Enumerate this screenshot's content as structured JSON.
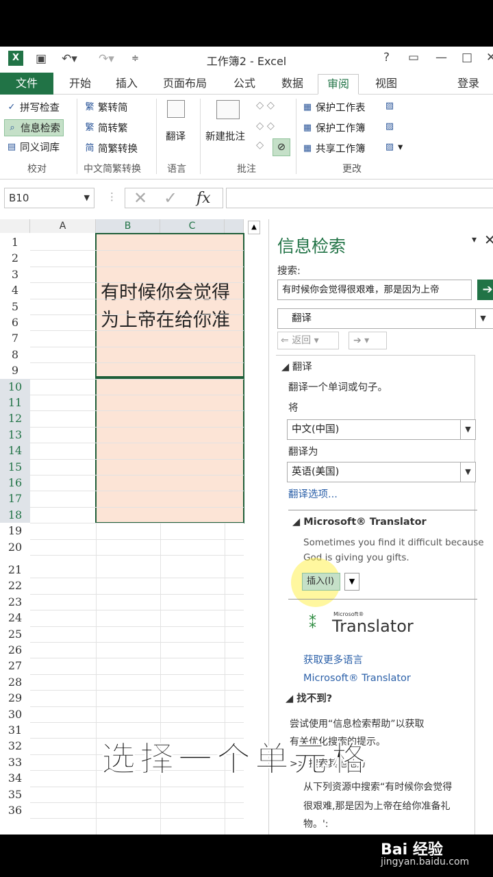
{
  "titlebar": {
    "app_title": "工作簿2 - Excel",
    "help": "?",
    "window_controls": [
      "restore-ribbon",
      "minimize",
      "maximize",
      "close"
    ]
  },
  "tabs": [
    "文件",
    "开始",
    "插入",
    "页面布局",
    "公式",
    "数据",
    "审阅",
    "视图"
  ],
  "active_tab": "审阅",
  "signin": "登录",
  "ribbon": {
    "proofing": {
      "items": [
        "拼写检查",
        "信息检索",
        "同义词库"
      ],
      "label": "校对"
    },
    "chinese": {
      "items": [
        "繁转简",
        "简转繁",
        "简繁转换"
      ],
      "label": "中文简繁转换"
    },
    "language": {
      "items": [
        "翻译"
      ],
      "label": "语言"
    },
    "comments": {
      "items": [
        "新建批注"
      ],
      "label": "批注"
    },
    "changes": {
      "items": [
        "保护工作表",
        "保护工作簿",
        "共享工作簿"
      ],
      "label": "更改"
    }
  },
  "formula_bar": {
    "name_box": "B10",
    "fx": "fx"
  },
  "grid": {
    "columns": [
      "A",
      "B",
      "C"
    ],
    "rows": [
      "1",
      "2",
      "3",
      "4",
      "5",
      "6",
      "7",
      "8",
      "9",
      "10",
      "11",
      "12",
      "13",
      "14",
      "15",
      "16",
      "17",
      "18",
      "19",
      "20",
      "21",
      "22",
      "23",
      "24",
      "25",
      "26",
      "27",
      "28",
      "29",
      "30",
      "31",
      "32",
      "33",
      "34",
      "35",
      "36"
    ],
    "cell_b4_line1": "有时候你会觉得",
    "cell_b4_line2": "为上帝在给你准"
  },
  "pane": {
    "title": "信息检索",
    "search_label": "搜索:",
    "search_value": "有时候你会觉得很艰难，那是因为上帝",
    "service": "翻译",
    "back": "返回",
    "section_title": "翻译",
    "section_desc": "翻译一个单词或句子。",
    "from_label": "将",
    "from_value": "中文(中国)",
    "to_label": "翻译为",
    "to_value": "英语(美国)",
    "options_link": "翻译选项...",
    "ms_title": "Microsoft® Translator",
    "ms_result_line1": "Sometimes you find it difficult because",
    "ms_result_line2": "God is giving you gifts.",
    "insert_btn": "插入(I)",
    "logo_small": "Microsoft®",
    "logo_big": "Translator",
    "more_langs": "获取更多语言",
    "ms_link": "Microsoft® Translator",
    "notfound_title": "找不到?",
    "notfound_desc": "尝试使用“信息检索帮助”以获取",
    "notfound_desc2": "有关优化搜索的提示。",
    "other_places": ">> 搜索其他地方",
    "from_sources_1": "从下列资源中搜索“有时候你会觉得",
    "from_sources_2": "很艰难,那是因为上帝在给你准备礼",
    "from_sources_3": "物。':"
  },
  "caption": "选择一个单元格",
  "watermark": "Bai 经验",
  "watermark_url": "jingyan.baidu.com"
}
